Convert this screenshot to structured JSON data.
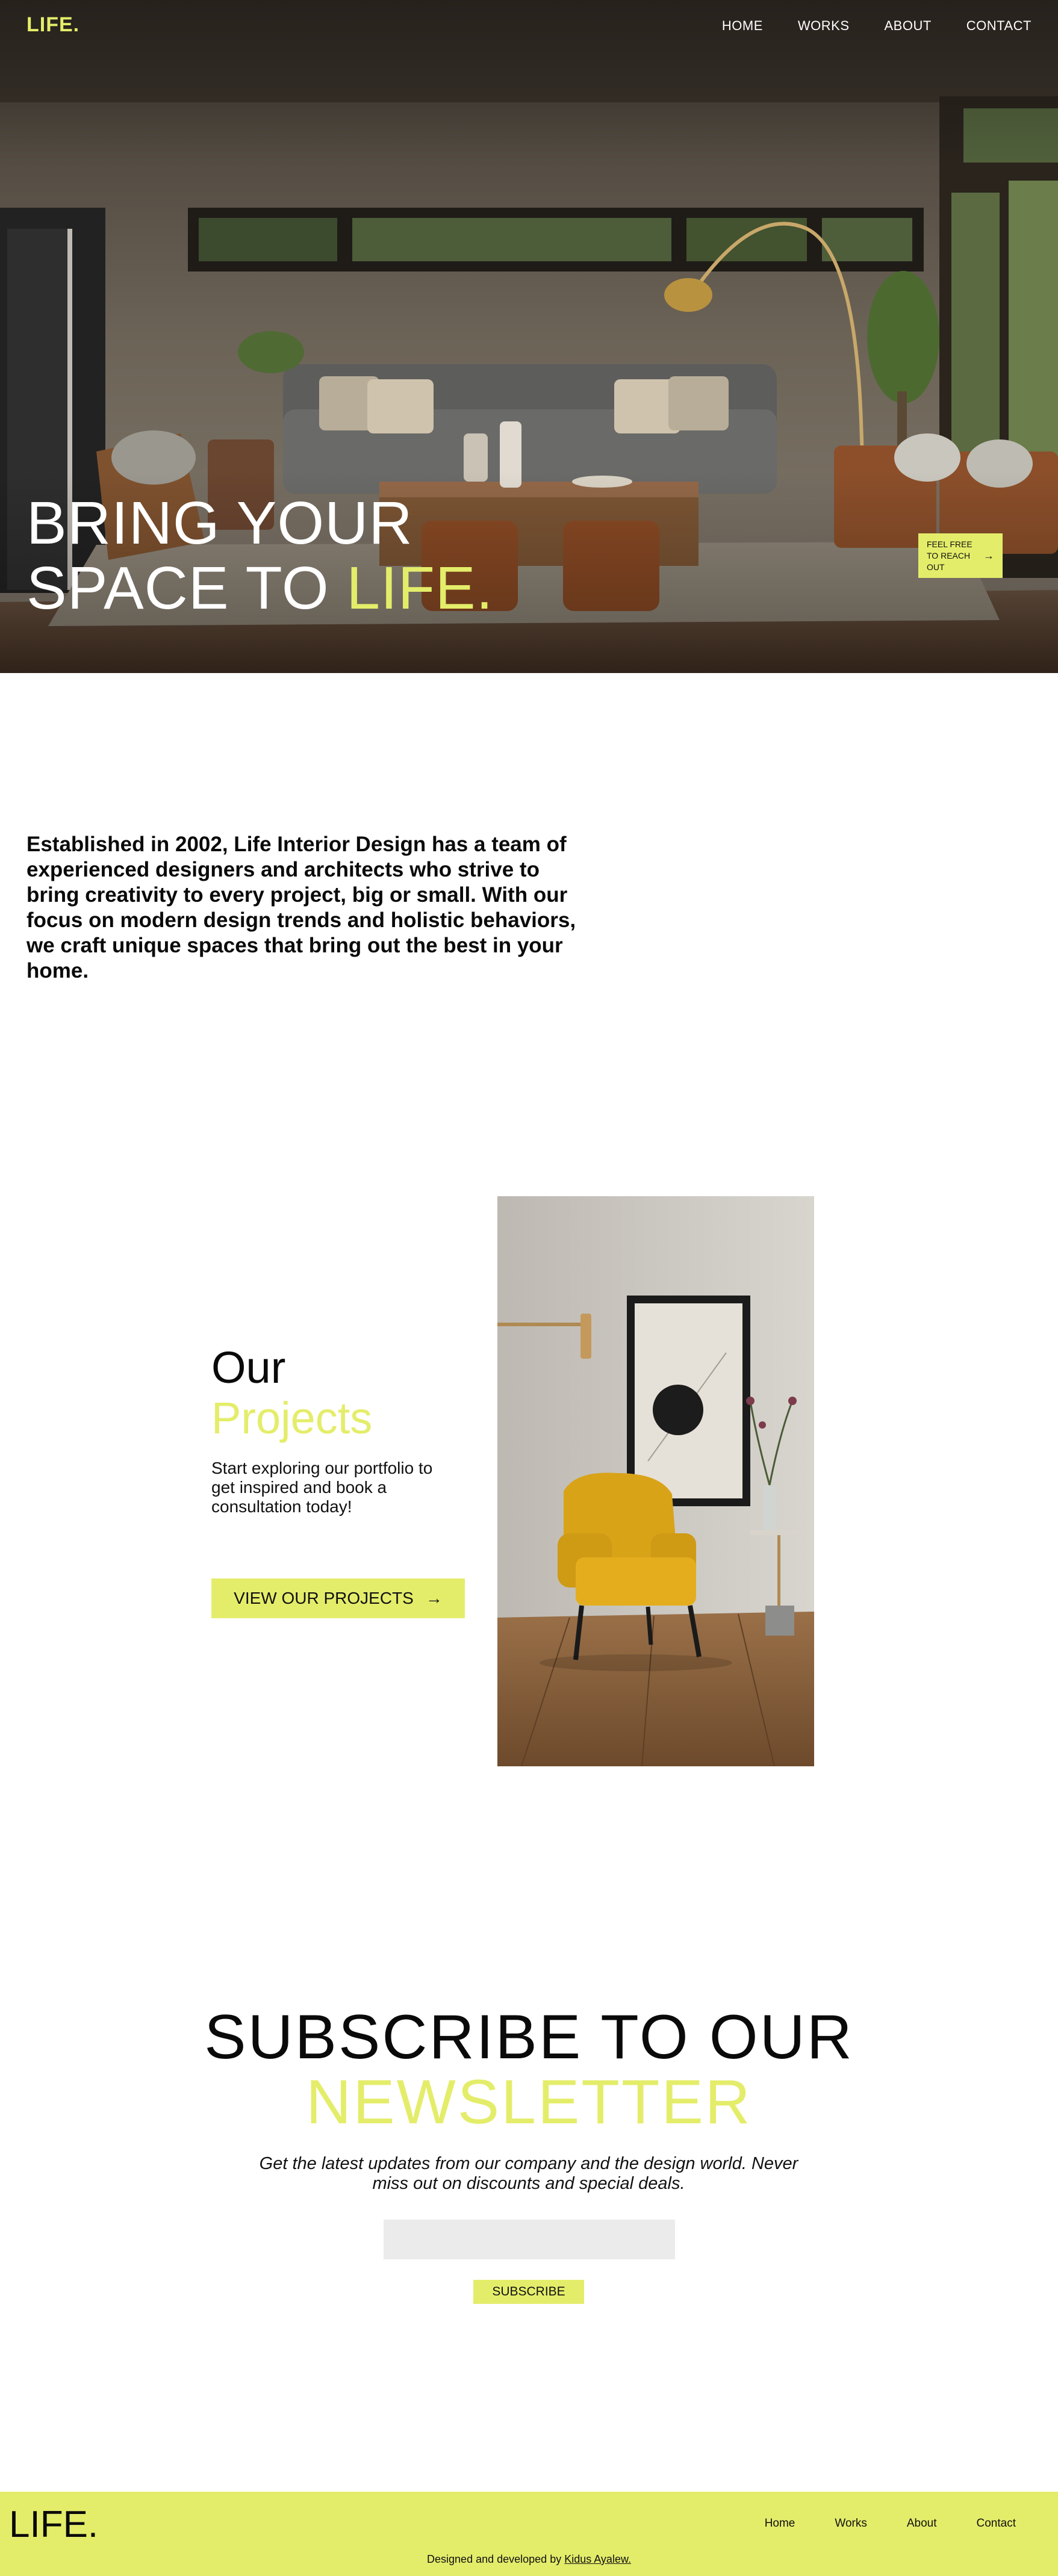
{
  "brand": {
    "logo": "LIFE.",
    "accent_color": "#e4ed6a"
  },
  "nav": {
    "items": [
      "HOME",
      "WORKS",
      "ABOUT",
      "CONTACT"
    ]
  },
  "hero": {
    "title_line1": "BRING YOUR",
    "title_line2_prefix": "SPACE TO ",
    "title_line2_accent": "LIFE.",
    "cta_label": "FEEL FREE TO REACH OUT",
    "cta_arrow": "→"
  },
  "intro": {
    "text": "Established in 2002, Life Interior Design has a team of experienced designers and architects who strive to bring creativity to every project, big or small. With our focus on modern design trends and holistic behaviors, we craft unique spaces that bring out the best in your home."
  },
  "projects": {
    "heading_line1": "Our",
    "heading_line2": "Projects",
    "description": "Start exploring our portfolio to get inspired and book a consultation today!",
    "button_label": "VIEW OUR PROJECTS",
    "button_arrow": "→"
  },
  "newsletter": {
    "heading_line1": "SUBSCRIBE TO OUR",
    "heading_line2": "NEWSLETTER",
    "description": "Get the latest updates from our company and the design world. Never miss out on discounts and special deals.",
    "input_placeholder": "",
    "button_label": "SUBSCRIBE"
  },
  "footer": {
    "logo": "LIFE.",
    "links": [
      "Home",
      "Works",
      "About",
      "Contact"
    ],
    "credit_prefix": "Designed and developed by ",
    "credit_name": "Kidus Ayalew."
  }
}
